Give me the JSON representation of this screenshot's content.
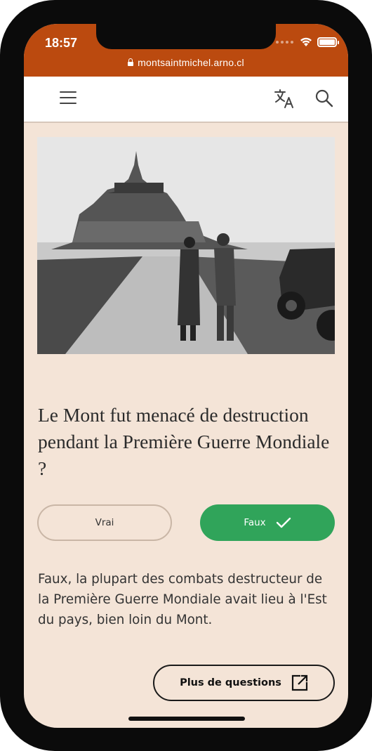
{
  "status_bar": {
    "time": "18:57",
    "icons": [
      "signal-dots-icon",
      "wifi-icon",
      "battery-icon"
    ]
  },
  "browser": {
    "url": "montsaintmichel.arno.cl"
  },
  "navbar": {
    "icons": [
      "menu-icon",
      "translate-icon",
      "search-icon"
    ]
  },
  "quiz": {
    "question": "Le Mont fut menacé de destruction pendant la Première Guerre Mondiale ?",
    "options": [
      {
        "label": "Vrai",
        "selected": false
      },
      {
        "label": "Faux",
        "selected": true,
        "correct": true
      }
    ],
    "answer_text": "Faux, la plupart des combats destructeur de la Première Guerre Mondiale avait lieu à l'Est du pays, bien loin du Mont.",
    "more_label": "Plus de questions"
  },
  "colors": {
    "status_bar_bg": "#bb4a0f",
    "page_bg": "#f4e4d7",
    "correct_green": "#30a45a"
  }
}
